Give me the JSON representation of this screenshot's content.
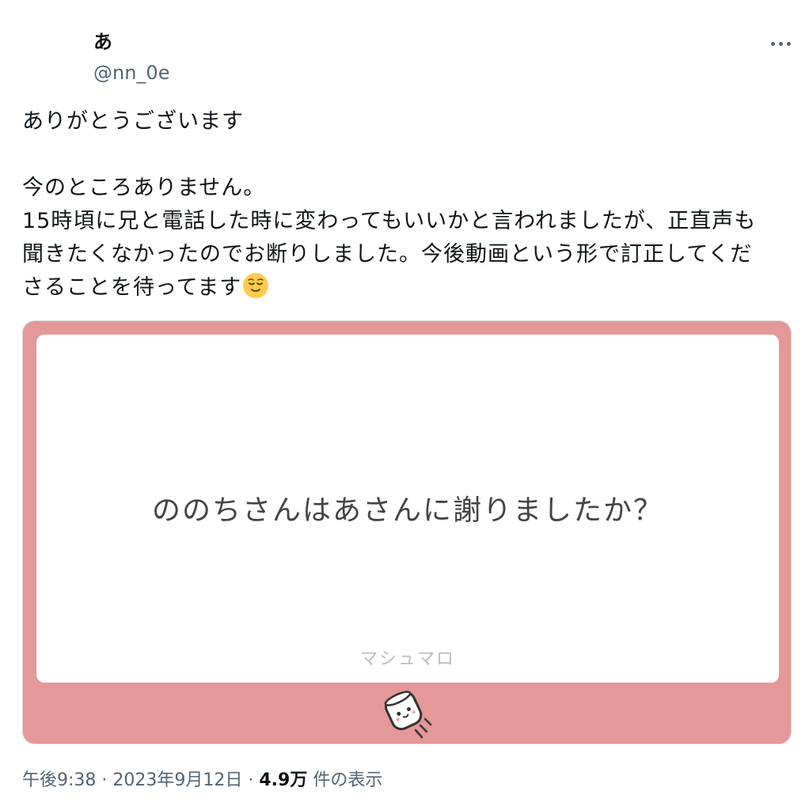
{
  "author": {
    "display_name": "あ",
    "handle": "@nn_0e"
  },
  "more_icon": "more-horizontal-icon",
  "tweet": {
    "lines": [
      "ありがとうございます",
      "",
      "今のところありません。",
      "15時頃に兄と電話した時に変わってもいいかと言われましたが、正直声も",
      "聞きたくなかったのでお断りしました。今後動画という形で訂正してくだ",
      "さることを待ってます"
    ],
    "emoji": "relieved-face-emoji"
  },
  "media": {
    "question": "ののちさんはあさんに謝りましたか？",
    "brand": "マシュマロ",
    "icon": "marshmallow-mascot-icon",
    "colors": {
      "frame": "#e49898",
      "panel": "#ffffff"
    }
  },
  "meta": {
    "time": "午後9:38",
    "sep1": " · ",
    "date": "2023年9月12日",
    "sep2": " · ",
    "views_count": "4.9万",
    "views_label": " 件の表示"
  }
}
